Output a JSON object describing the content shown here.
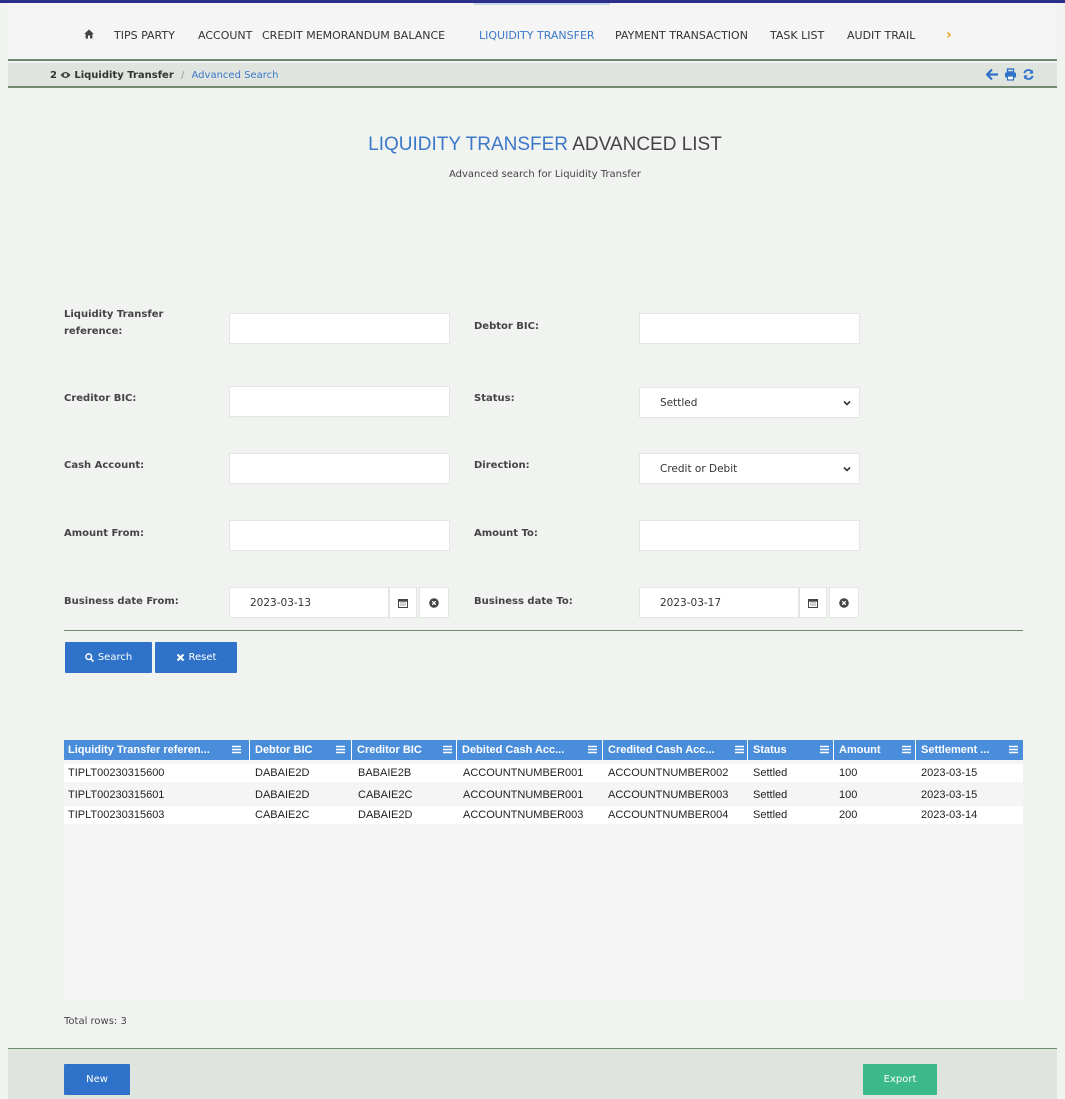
{
  "nav": {
    "items": [
      "TIPS PARTY",
      "ACCOUNT",
      "CREDIT MEMORANDUM BALANCE",
      "LIQUIDITY TRANSFER",
      "PAYMENT TRANSACTION",
      "TASK LIST",
      "AUDIT TRAIL"
    ],
    "active": "LIQUIDITY TRANSFER",
    "home_icon": "home-icon",
    "more_icon": "chevron-right-icon"
  },
  "breadcrumb": {
    "count": "2",
    "eye_icon": "eye-icon",
    "current": "Liquidity Transfer",
    "separator": "/",
    "link": "Advanced Search",
    "icons": [
      "arrow-left-icon",
      "print-icon",
      "refresh-icon"
    ]
  },
  "page": {
    "title_highlight": "LIQUIDITY TRANSFER",
    "title_rest": " ADVANCED LIST",
    "subtitle": "Advanced search for Liquidity Transfer"
  },
  "form": {
    "lt_reference_label": "Liquidity Transfer reference:",
    "lt_reference_value": "",
    "debtor_bic_label": "Debtor BIC:",
    "debtor_bic_value": "",
    "creditor_bic_label": "Creditor BIC:",
    "creditor_bic_value": "",
    "status_label": "Status:",
    "status_value": "Settled",
    "cash_account_label": "Cash Account:",
    "cash_account_value": "",
    "direction_label": "Direction:",
    "direction_value": "Credit or Debit",
    "amount_from_label": "Amount From:",
    "amount_from_value": "",
    "amount_to_label": "Amount To:",
    "amount_to_value": "",
    "date_from_label": "Business date From:",
    "date_from_value": "2023-03-13",
    "date_to_label": "Business date To:",
    "date_to_value": "2023-03-17"
  },
  "buttons": {
    "search": "Search",
    "reset": "Reset",
    "new": "New",
    "export": "Export"
  },
  "grid": {
    "columns": [
      "Liquidity Transfer referen...",
      "Debtor BIC",
      "Creditor BIC",
      "Debited Cash Acc...",
      "Credited Cash Acc...",
      "Status",
      "Amount",
      "Settlement ..."
    ],
    "rows": [
      [
        "TIPLT00230315600",
        "DABAIE2D",
        "BABAIE2B",
        "ACCOUNTNUMBER001",
        "ACCOUNTNUMBER002",
        "Settled",
        "100",
        "2023-03-15"
      ],
      [
        "TIPLT00230315601",
        "DABAIE2D",
        "CABAIE2C",
        "ACCOUNTNUMBER001",
        "ACCOUNTNUMBER003",
        "Settled",
        "100",
        "2023-03-15"
      ],
      [
        "TIPLT00230315603",
        "CABAIE2C",
        "DABAIE2D",
        "ACCOUNTNUMBER003",
        "ACCOUNTNUMBER004",
        "Settled",
        "200",
        "2023-03-14"
      ]
    ],
    "total_label": "Total rows: 3"
  },
  "colors": {
    "accent": "#3b78c8",
    "button_primary": "#2f72c9",
    "button_export": "#3cb98a",
    "grid_header": "#4a8edb",
    "nav_more": "#f0a020"
  }
}
